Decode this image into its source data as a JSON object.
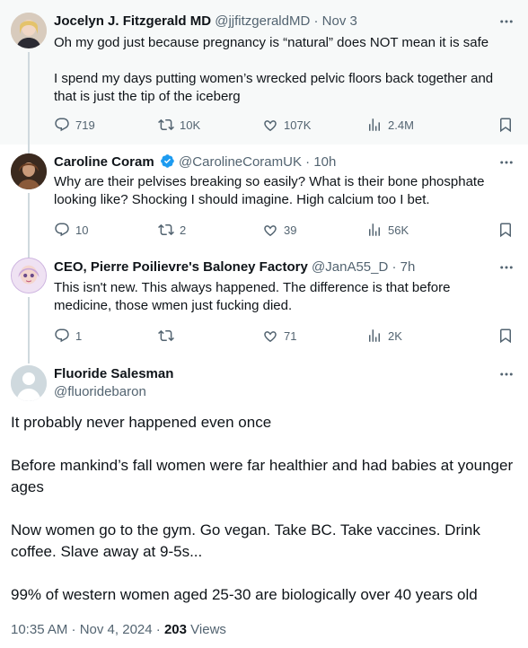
{
  "tweets": [
    {
      "name": "Jocelyn J. Fitzgerald MD",
      "handle": "@jjfitzgeraldMD",
      "time": "Nov 3",
      "verified": false,
      "paragraphs": [
        "Oh my god just because pregnancy is “natural” does NOT mean it is safe",
        "I spend my days putting women’s wrecked pelvic floors back together and that is just the tip of the iceberg"
      ],
      "replies": "719",
      "reposts": "10K",
      "likes": "107K",
      "views": "2.4M"
    },
    {
      "name": "Caroline Coram",
      "handle": "@CarolineCoramUK",
      "time": "10h",
      "verified": true,
      "paragraphs": [
        "Why are their pelvises breaking so easily? What is their bone phosphate looking like? Shocking I should imagine. High calcium too I bet."
      ],
      "replies": "10",
      "reposts": "2",
      "likes": "39",
      "views": "56K"
    },
    {
      "name": "CEO, Pierre Poilievre's Baloney Factory",
      "handle": "@JanA55_D",
      "time": "7h",
      "verified": false,
      "paragraphs": [
        "This isn't new. This always happened. The difference is that before medicine, those wmen just fucking died."
      ],
      "replies": "1",
      "reposts": "",
      "likes": "71",
      "views": "2K"
    }
  ],
  "main": {
    "name": "Fluoride Salesman",
    "handle": "@fluoridebaron",
    "paragraphs": [
      "It probably never happened even once",
      "Before mankind’s fall women were far healthier and had babies at younger ages",
      "Now women go to the gym. Go vegan. Take BC. Take vaccines. Drink coffee. Slave away at 9-5s...",
      "99% of western women aged 25-30 are biologically over 40 years old"
    ],
    "timestamp": "10:35 AM · Nov 4, 2024",
    "views_count": "203",
    "views_label": "Views"
  },
  "ui": {
    "separator": " · ",
    "more_label": "More"
  },
  "colors": {
    "text": "#0f1419",
    "secondary": "#536471",
    "verified": "#1d9bf0",
    "highlight_bg": "#f7f9f9"
  }
}
